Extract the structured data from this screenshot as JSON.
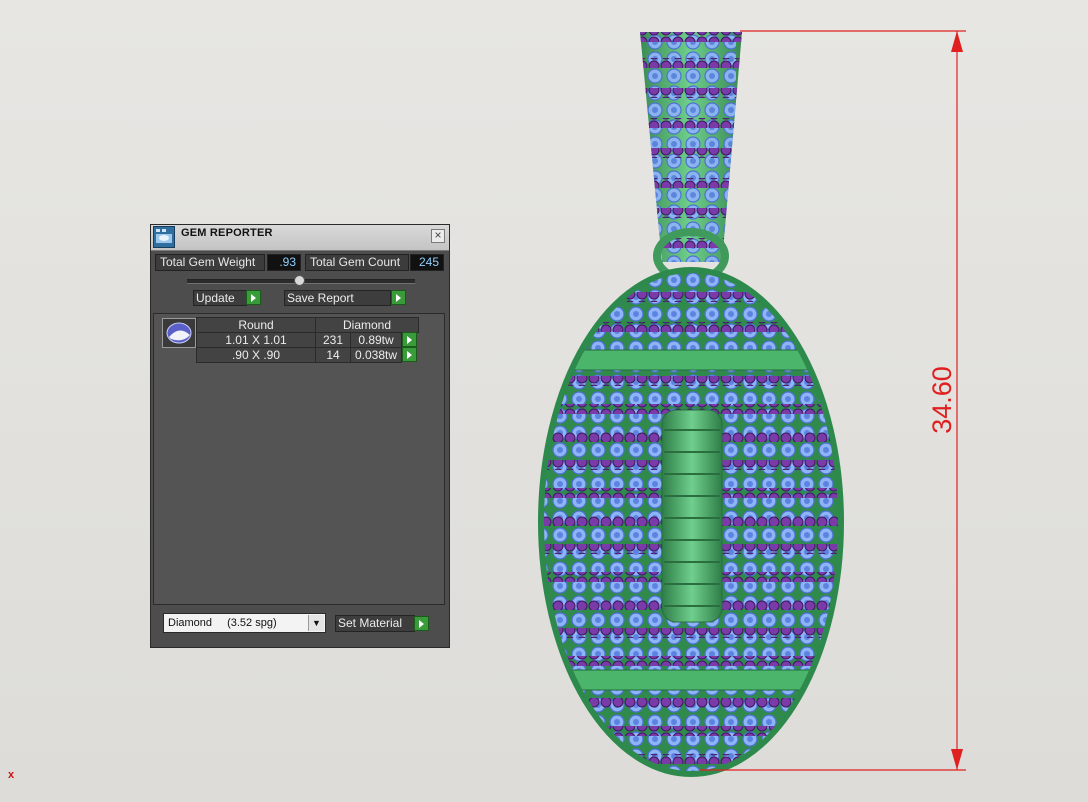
{
  "panel": {
    "title": "GEM REPORTER",
    "close_glyph": "×",
    "total_gem_weight_label": "Total Gem Weight",
    "total_gem_weight_value": ".93",
    "total_gem_count_label": "Total Gem Count",
    "total_gem_count_value": "245",
    "update_label": "Update",
    "save_report_label": "Save Report",
    "table": {
      "headers": [
        "Round",
        "Diamond"
      ],
      "rows": [
        {
          "size": "1.01 X 1.01",
          "count": "231",
          "weight": "0.89tw"
        },
        {
          "size": ".90 X .90",
          "count": "14",
          "weight": "0.038tw"
        }
      ]
    },
    "material_select": {
      "name": "Diamond",
      "gravity": "(3.52 spg)"
    },
    "set_material_label": "Set Material",
    "icons": [
      "gem-reporter-icon",
      "close-icon",
      "round-gem-icon",
      "dropdown-arrow-icon",
      "go-arrow-icon"
    ]
  },
  "viewport": {
    "dimension_value": "34.60",
    "dimension_color": "#e02020",
    "origin_marker": "x"
  },
  "colors": {
    "metal": "#3f9a5c",
    "stone_blue": "#7aa7f0",
    "stone_purple": "#6a2f9a",
    "go_button": "#3a9b3a"
  }
}
